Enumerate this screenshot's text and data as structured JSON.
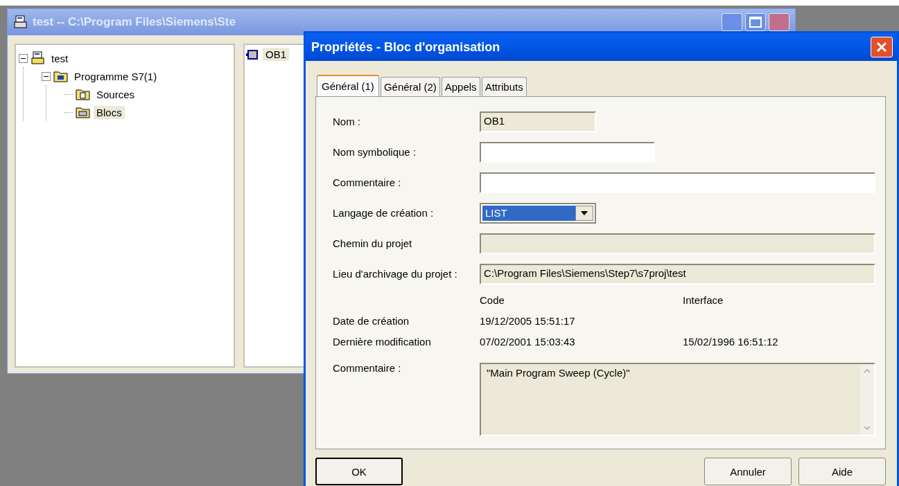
{
  "main_window": {
    "title": "test -- C:\\Program Files\\Siemens\\Ste",
    "tree": [
      {
        "label": "test",
        "kind": "project",
        "expanded": true,
        "selected": false,
        "children": [
          {
            "label": "Programme S7(1)",
            "kind": "program",
            "expanded": true,
            "selected": false,
            "children": [
              {
                "label": "Sources",
                "kind": "sources",
                "selected": false
              },
              {
                "label": "Blocs",
                "kind": "blocks",
                "selected": true
              }
            ]
          }
        ]
      }
    ],
    "list": [
      {
        "label": "OB1",
        "selected": true
      }
    ]
  },
  "dialog": {
    "title": "Propriétés - Bloc d'organisation",
    "tabs": [
      {
        "label": "Général (1)",
        "selected": true
      },
      {
        "label": "Général (2)",
        "selected": false
      },
      {
        "label": "Appels",
        "selected": false
      },
      {
        "label": "Attributs",
        "selected": false
      }
    ],
    "fields": [
      {
        "kind": "readonly",
        "label": "Nom :",
        "value": "OB1"
      },
      {
        "kind": "text",
        "label": "Nom symbolique :"
      },
      {
        "kind": "text",
        "label": "Commentaire :"
      },
      {
        "kind": "combo",
        "label": "Langage de création :",
        "value": "LIST"
      },
      {
        "kind": "readonly",
        "label": "Chemin du projet"
      },
      {
        "kind": "readonly",
        "label": "Lieu d'archivage du projet :",
        "value": "C:\\Program Files\\Siemens\\Step7\\s7proj\\test"
      }
    ],
    "dates": {
      "columns": [
        "Code",
        "Interface"
      ],
      "rows": [
        {
          "label": "Date de création",
          "values": [
            "19/12/2005 15:51:17"
          ]
        },
        {
          "label": "Dernière modification",
          "values": [
            "07/02/2001 15:03:43",
            "15/02/1996 16:51:12"
          ]
        }
      ]
    },
    "comment": {
      "label": "Commentaire :",
      "value": "\"Main Program Sweep (Cycle)\""
    },
    "buttons": [
      {
        "label": "OK",
        "default": true
      },
      {
        "label": "Annuler",
        "default": false
      },
      {
        "label": "Aide",
        "default": false
      }
    ]
  }
}
